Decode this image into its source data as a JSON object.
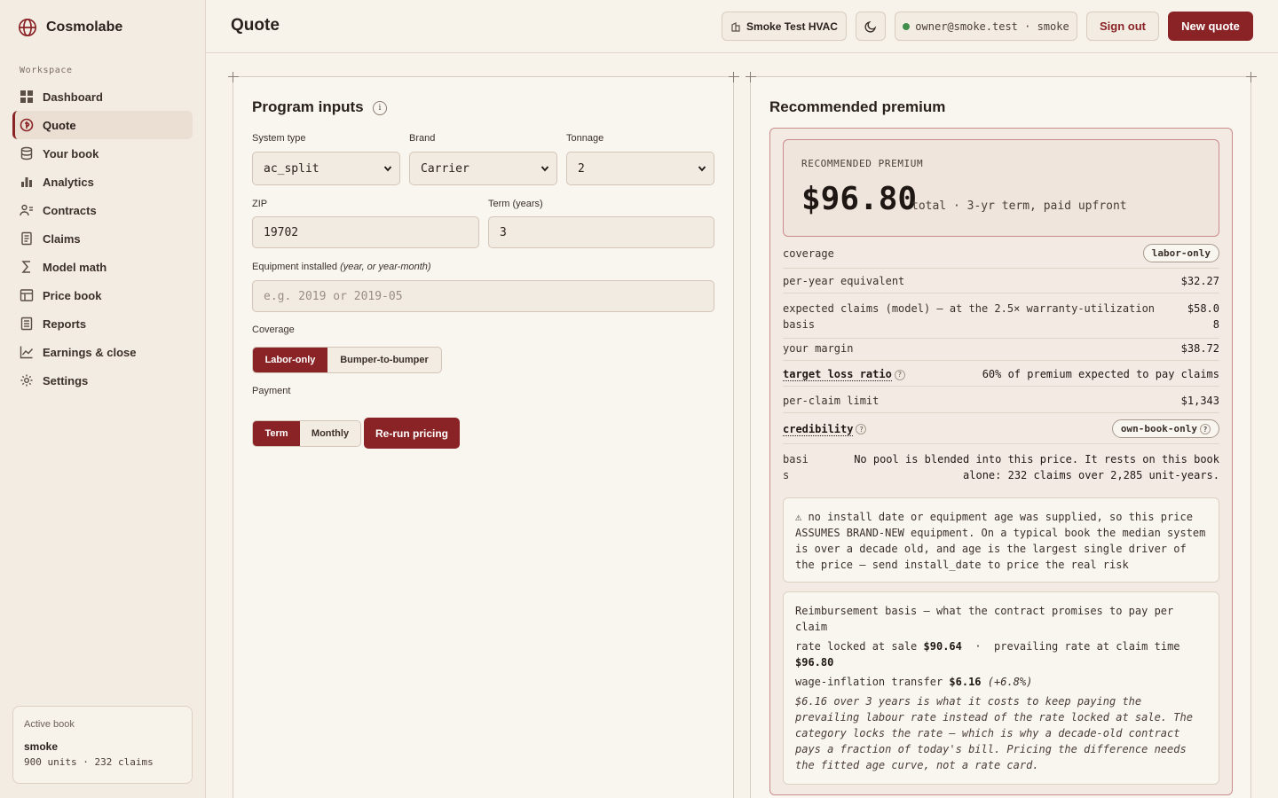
{
  "app": {
    "name": "Cosmolabe"
  },
  "sidebar": {
    "section_label": "Workspace",
    "items": [
      {
        "label": "Dashboard",
        "icon": "dashboard-icon"
      },
      {
        "label": "Quote",
        "icon": "quote-icon",
        "active": true
      },
      {
        "label": "Your book",
        "icon": "database-icon"
      },
      {
        "label": "Analytics",
        "icon": "bar-chart-icon"
      },
      {
        "label": "Contracts",
        "icon": "users-icon"
      },
      {
        "label": "Claims",
        "icon": "document-icon"
      },
      {
        "label": "Model math",
        "icon": "sigma-icon"
      },
      {
        "label": "Price book",
        "icon": "table-icon"
      },
      {
        "label": "Reports",
        "icon": "report-icon"
      },
      {
        "label": "Earnings & close",
        "icon": "line-chart-icon"
      },
      {
        "label": "Settings",
        "icon": "gear-icon"
      }
    ],
    "active_book": {
      "label": "Active book",
      "name": "smoke",
      "meta": "900 units · 232 claims"
    }
  },
  "topbar": {
    "title": "Quote",
    "tenant": "Smoke Test HVAC",
    "user": "owner@smoke.test · smoke",
    "sign_out": "Sign out",
    "new_quote": "New quote"
  },
  "inputs": {
    "title": "Program inputs",
    "info": "i",
    "system_type": {
      "label": "System type",
      "value": "ac_split"
    },
    "brand": {
      "label": "Brand",
      "value": "Carrier"
    },
    "tonnage": {
      "label": "Tonnage",
      "value": "2"
    },
    "zip": {
      "label": "ZIP",
      "value": "19702"
    },
    "term": {
      "label": "Term (years)",
      "value": "3"
    },
    "equipment": {
      "label": "Equipment installed",
      "label_hint": "(year, or year-month)",
      "placeholder": "e.g. 2019 or 2019-05"
    },
    "coverage": {
      "label": "Coverage",
      "options": [
        "Labor-only",
        "Bumper-to-bumper"
      ],
      "selected": "Labor-only"
    },
    "payment": {
      "label": "Payment",
      "options": [
        "Term",
        "Monthly"
      ],
      "selected": "Term"
    },
    "rerun": "Re-run pricing"
  },
  "premium": {
    "title": "Recommended premium",
    "caption": "RECOMMENDED PREMIUM",
    "amount": "$96.80",
    "amount_sub": "total · 3-yr term, paid upfront",
    "rows": {
      "coverage": {
        "key": "coverage",
        "value": "labor-only"
      },
      "per_year": {
        "key": "per-year equivalent",
        "value": "$32.27"
      },
      "expected": {
        "key": "expected claims (model) — at the 2.5× warranty-utilization basis",
        "value": "$58.08"
      },
      "margin": {
        "key": "your margin",
        "value": "$38.72"
      },
      "loss_ratio": {
        "key": "target loss ratio",
        "value": "60% of premium expected to pay claims"
      },
      "limit": {
        "key": "per-claim limit",
        "value": "$1,343"
      },
      "credibility": {
        "key": "credibility",
        "value": "own-book-only"
      },
      "basis": {
        "key": "basis",
        "value": "No pool is blended into this price. It rests on this book alone: 232 claims over 2,285 unit-years."
      }
    },
    "help_mark": "?",
    "warning": "⚠ no install date or equipment age was supplied, so this price ASSUMES BRAND-NEW equipment. On a typical book the median system is over a decade old, and age is the largest single driver of the price — send install_date to price the real risk",
    "reimbursement": {
      "heading": "Reimbursement basis — what the contract promises to pay per claim",
      "locked_label": "rate locked at sale",
      "locked_value": "$90.64",
      "sep": "·",
      "prevailing_label": "prevailing rate at claim time",
      "prevailing_value": "$96.80",
      "transfer_label": "wage-inflation transfer",
      "transfer_value": "$6.16",
      "transfer_pct": "(+6.8%)",
      "note": "$6.16 over 3 years is what it costs to keep paying the prevailing labour rate instead of the rate locked at sale. The category locks the rate — which is why a decade-old contract pays a fraction of today's bill. Pricing the difference needs the fitted age curve, not a rate card."
    }
  },
  "colors": {
    "accent": "#8a2326",
    "background": "#f7f2ea",
    "sidebar": "#f3ece3",
    "status_online": "#3f8f4a"
  }
}
